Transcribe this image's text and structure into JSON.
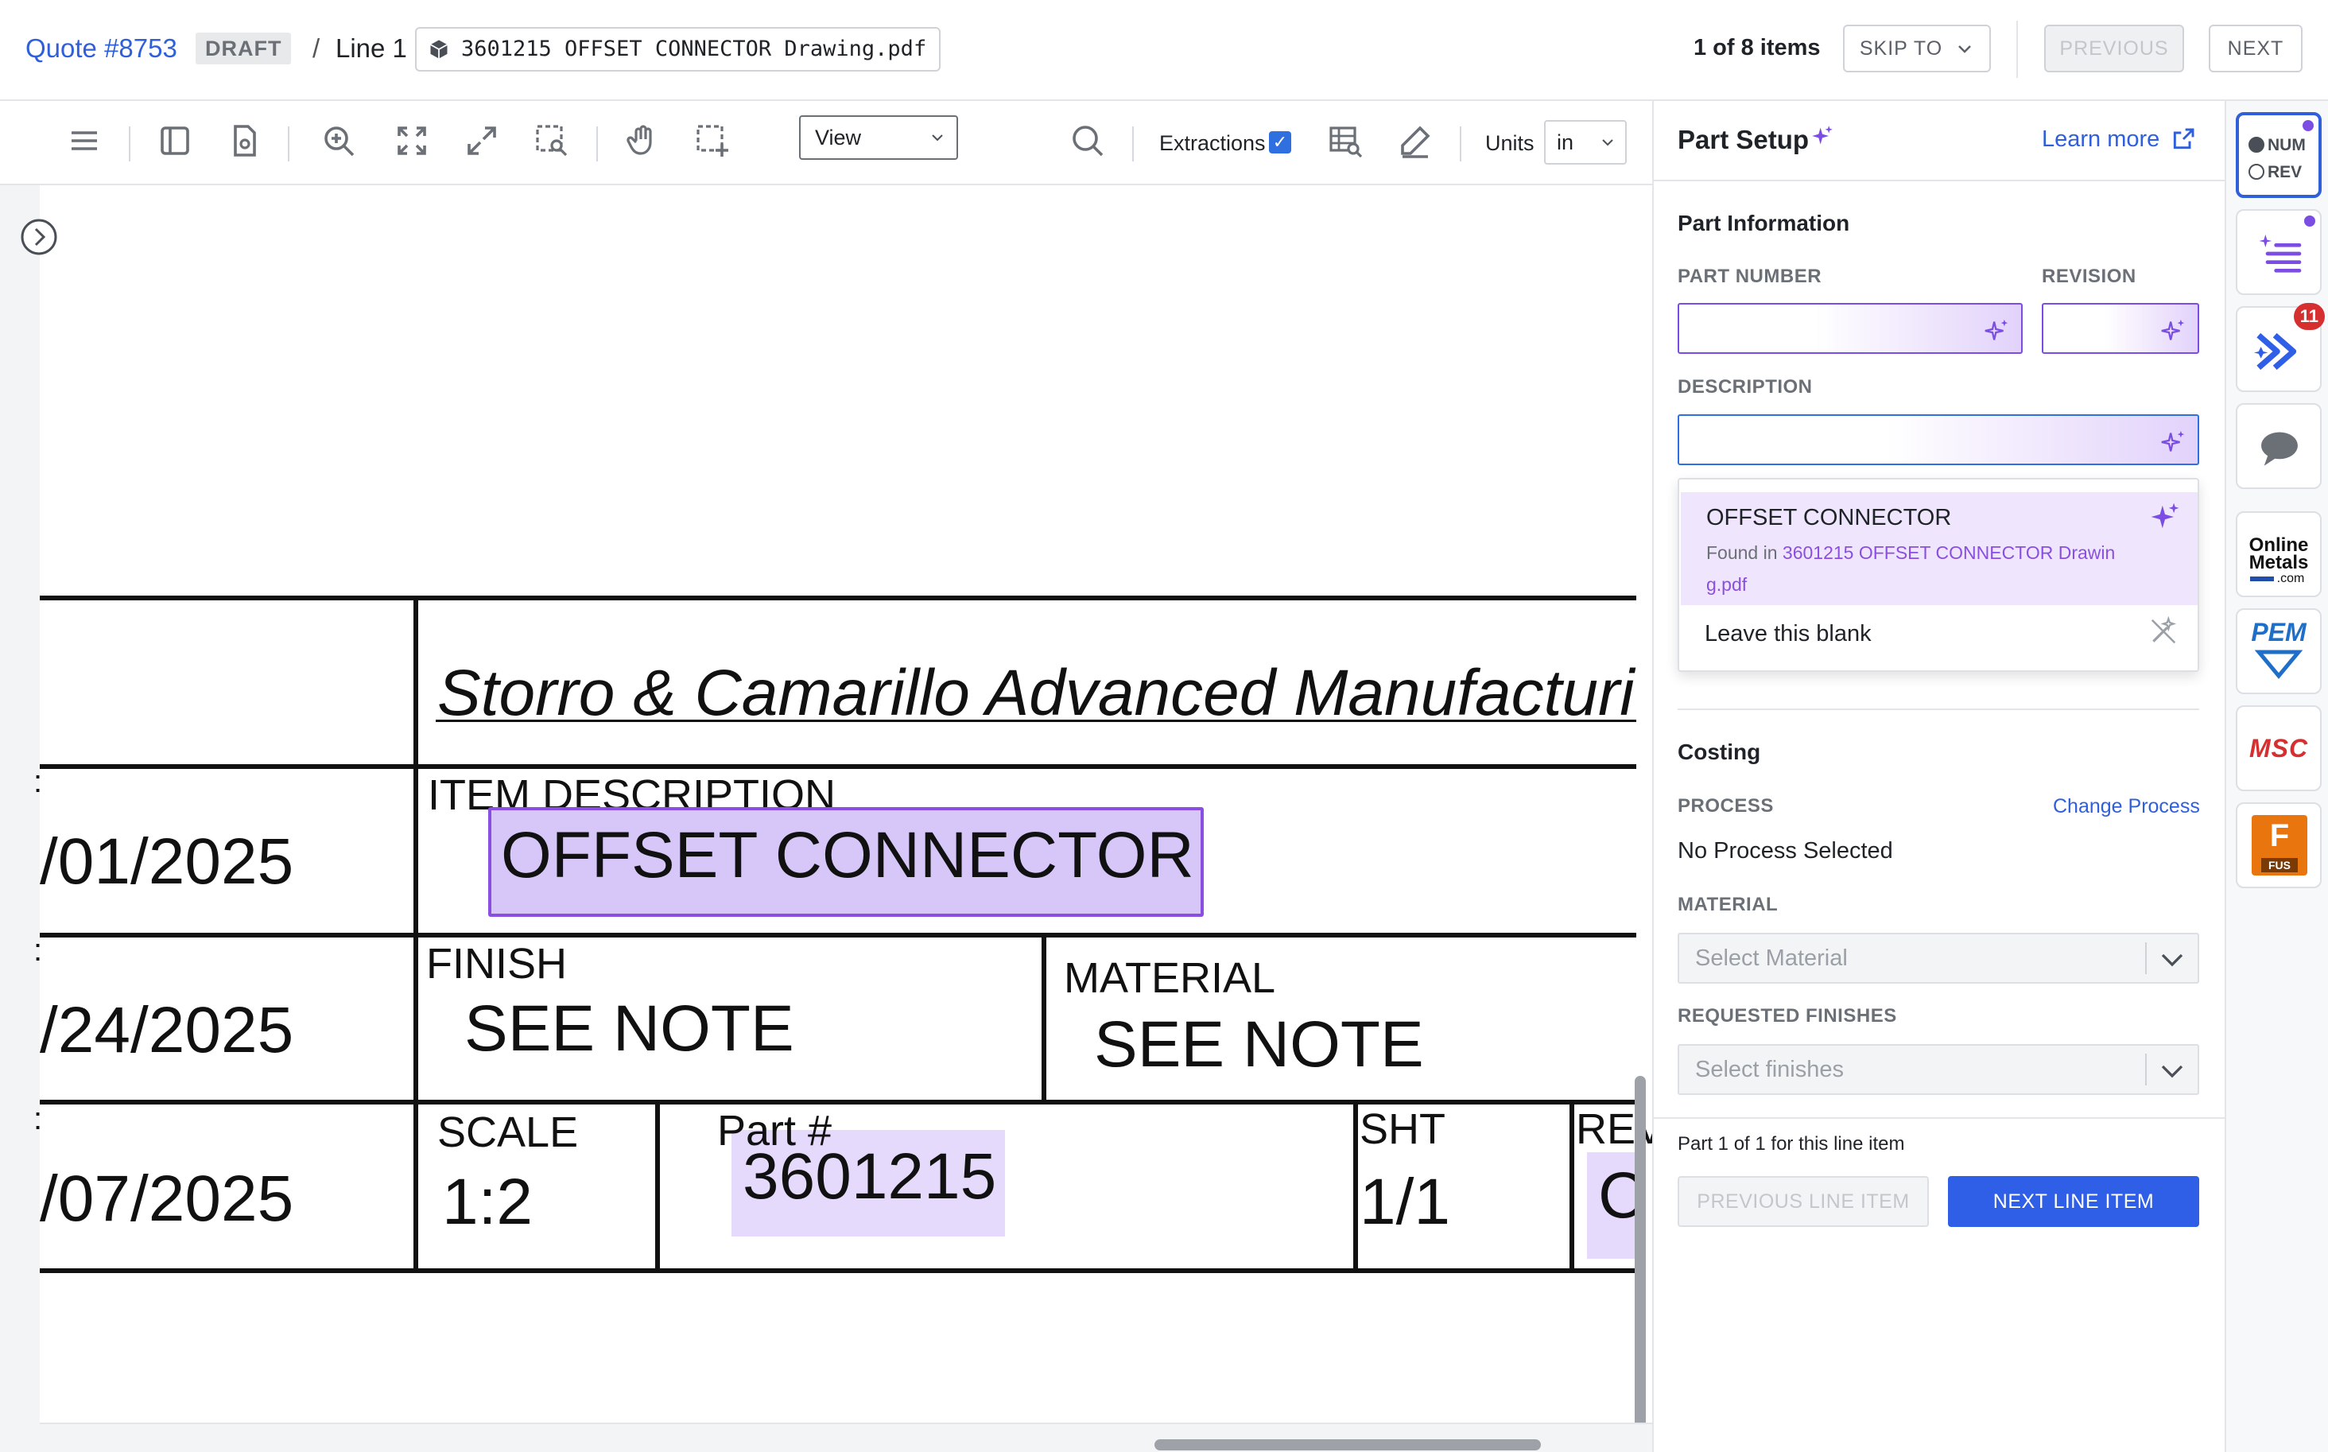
{
  "header": {
    "quote_link": "Quote #8753",
    "status_badge": "DRAFT",
    "separator": "/",
    "line_label": "Line 1",
    "file_name": "3601215 OFFSET CONNECTOR Drawing.pdf",
    "items_count": "1 of 8 items",
    "skip_to_label": "SKIP TO",
    "previous_label": "PREVIOUS",
    "next_label": "NEXT"
  },
  "toolbar": {
    "icons": [
      "menu-icon",
      "sidebar-icon",
      "file-settings-icon",
      "zoom-in-icon",
      "fit-page-icon",
      "expand-icon",
      "zoom-region-icon",
      "hand-icon",
      "select-region-icon",
      "search-icon",
      "table-search-icon",
      "pen-icon"
    ],
    "view_select": "View",
    "extractions_label": "Extractions",
    "extractions_checked": true,
    "units_label": "Units",
    "units_value": "in"
  },
  "drawing": {
    "company": "Storro & Camarillo Advanced Manufacturi",
    "date_1": "/01/2025",
    "date_2": "/24/2025",
    "date_3": "/07/2025",
    "item_description_label": "ITEM  DESCRIPTION",
    "item_description_value": "OFFSET CONNECTOR",
    "finish_label": "FINISH",
    "finish_value": "SEE NOTE",
    "material_label": "MATERIAL",
    "material_value": "SEE NOTE",
    "scale_label": "SCALE",
    "scale_value": "1:2",
    "part_label": "Part #",
    "part_value": "3601215",
    "sheet_label": "SHT",
    "sheet_value": "1/1",
    "rev_label": "REV",
    "rev_value": "C",
    "colon_marks": [
      ":",
      ":",
      ":"
    ]
  },
  "panel": {
    "title": "Part Setup",
    "learn_more": "Learn more",
    "part_info_title": "Part Information",
    "part_number_label": "PART NUMBER",
    "revision_label": "REVISION",
    "description_label": "DESCRIPTION",
    "suggestion": {
      "title": "OFFSET CONNECTOR",
      "found_prefix": "Found in ",
      "found_file": "3601215 OFFSET CONNECTOR Drawin g.pdf",
      "leave_blank": "Leave this blank"
    },
    "costing_title": "Costing",
    "process_label": "PROCESS",
    "change_process": "Change Process",
    "process_value": "No Process Selected",
    "material_label": "MATERIAL",
    "material_placeholder": "Select Material",
    "finishes_label": "REQUESTED FINISHES",
    "finishes_placeholder": "Select finishes",
    "part_of": "Part 1 of 1 for this line item",
    "prev_line_item": "PREVIOUS LINE ITEM",
    "next_line_item": "NEXT LINE ITEM"
  },
  "rail": {
    "numrev_num": "NUM",
    "numrev_rev": "REV",
    "notification_count": "11",
    "online_metals": [
      "Online",
      "Metals",
      ".com"
    ],
    "pem_label": "PEM",
    "msc_label": "MSC",
    "fusion_letter": "F",
    "fusion_label": "FUS"
  },
  "colors": {
    "accent_blue": "#2f5fd9",
    "ai_purple": "#7b4de3",
    "highlight": "#c8b4f5",
    "badge_red": "#d62f2f"
  }
}
